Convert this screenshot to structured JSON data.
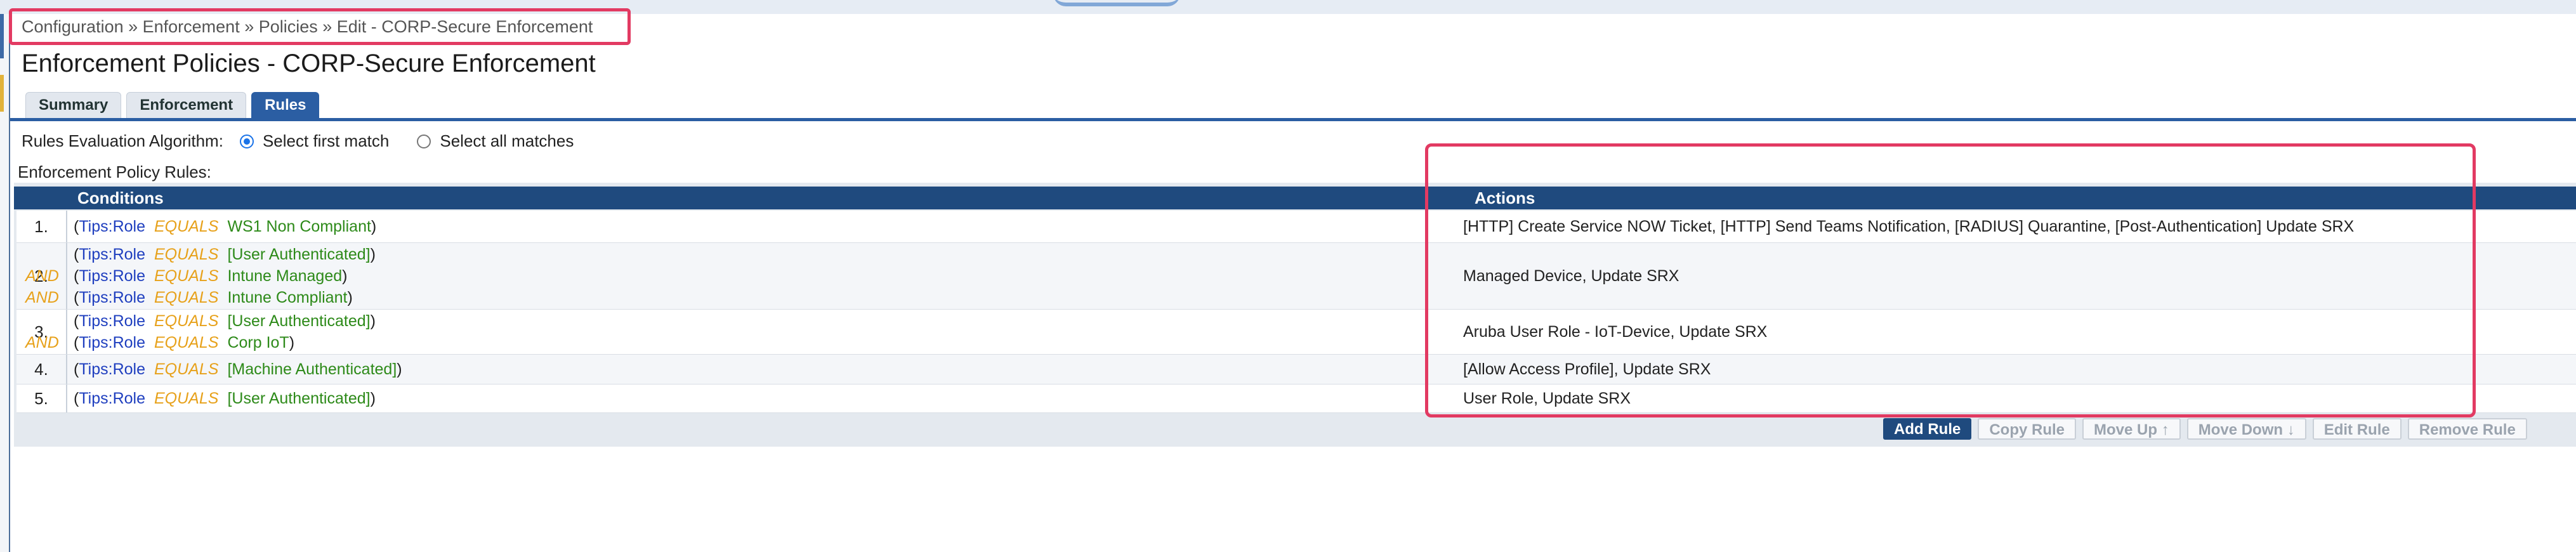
{
  "breadcrumb": {
    "items": [
      "Configuration",
      "Enforcement",
      "Policies",
      "Edit - CORP-Secure Enforcement"
    ],
    "separator": "»",
    "text": "Configuration » Enforcement » Policies » Edit - CORP-Secure Enforcement"
  },
  "page": {
    "title": "Enforcement Policies - CORP-Secure Enforcement"
  },
  "tabs": [
    {
      "label": "Summary",
      "active": false
    },
    {
      "label": "Enforcement",
      "active": false
    },
    {
      "label": "Rules",
      "active": true
    }
  ],
  "algorithm": {
    "label": "Rules Evaluation Algorithm:",
    "options": [
      {
        "label": "Select first match",
        "selected": true
      },
      {
        "label": "Select all matches",
        "selected": false
      }
    ]
  },
  "rules_label": "Enforcement Policy Rules:",
  "table": {
    "headers": {
      "conditions": "Conditions",
      "actions": "Actions"
    },
    "rows": [
      {
        "num": "1.",
        "conditions": [
          {
            "conj": "",
            "attr": "Tips:Role",
            "op": "EQUALS",
            "value": "WS1 Non Compliant"
          }
        ],
        "actions": "[HTTP] Create Service NOW Ticket, [HTTP] Send Teams Notification, [RADIUS] Quarantine, [Post-Authentication] Update SRX"
      },
      {
        "num": "2.",
        "conditions": [
          {
            "conj": "",
            "attr": "Tips:Role",
            "op": "EQUALS",
            "value": "[User Authenticated]"
          },
          {
            "conj": "AND",
            "attr": "Tips:Role",
            "op": "EQUALS",
            "value": "Intune Managed"
          },
          {
            "conj": "AND",
            "attr": "Tips:Role",
            "op": "EQUALS",
            "value": "Intune Compliant"
          }
        ],
        "actions": "Managed Device, Update SRX"
      },
      {
        "num": "3.",
        "conditions": [
          {
            "conj": "",
            "attr": "Tips:Role",
            "op": "EQUALS",
            "value": "[User Authenticated]"
          },
          {
            "conj": "AND",
            "attr": "Tips:Role",
            "op": "EQUALS",
            "value": "Corp IoT"
          }
        ],
        "actions": "Aruba User Role - IoT-Device, Update SRX"
      },
      {
        "num": "4.",
        "conditions": [
          {
            "conj": "",
            "attr": "Tips:Role",
            "op": "EQUALS",
            "value": "[Machine Authenticated]"
          }
        ],
        "actions": "[Allow Access Profile], Update SRX"
      },
      {
        "num": "5.",
        "conditions": [
          {
            "conj": "",
            "attr": "Tips:Role",
            "op": "EQUALS",
            "value": "[User Authenticated]"
          }
        ],
        "actions": "User Role, Update SRX"
      }
    ]
  },
  "buttons": [
    {
      "label": "Add Rule",
      "enabled": true
    },
    {
      "label": "Copy Rule",
      "enabled": false
    },
    {
      "label": "Move Up ↑",
      "enabled": false
    },
    {
      "label": "Move Down ↓",
      "enabled": false
    },
    {
      "label": "Edit Rule",
      "enabled": false
    },
    {
      "label": "Remove Rule",
      "enabled": false
    }
  ],
  "colors": {
    "header_bg": "#1f4a7e",
    "tab_active": "#2b5ea3",
    "highlight_box": "#e23a62",
    "attr": "#1f3fbf",
    "operator": "#e7a11a",
    "value": "#2d8a19"
  }
}
